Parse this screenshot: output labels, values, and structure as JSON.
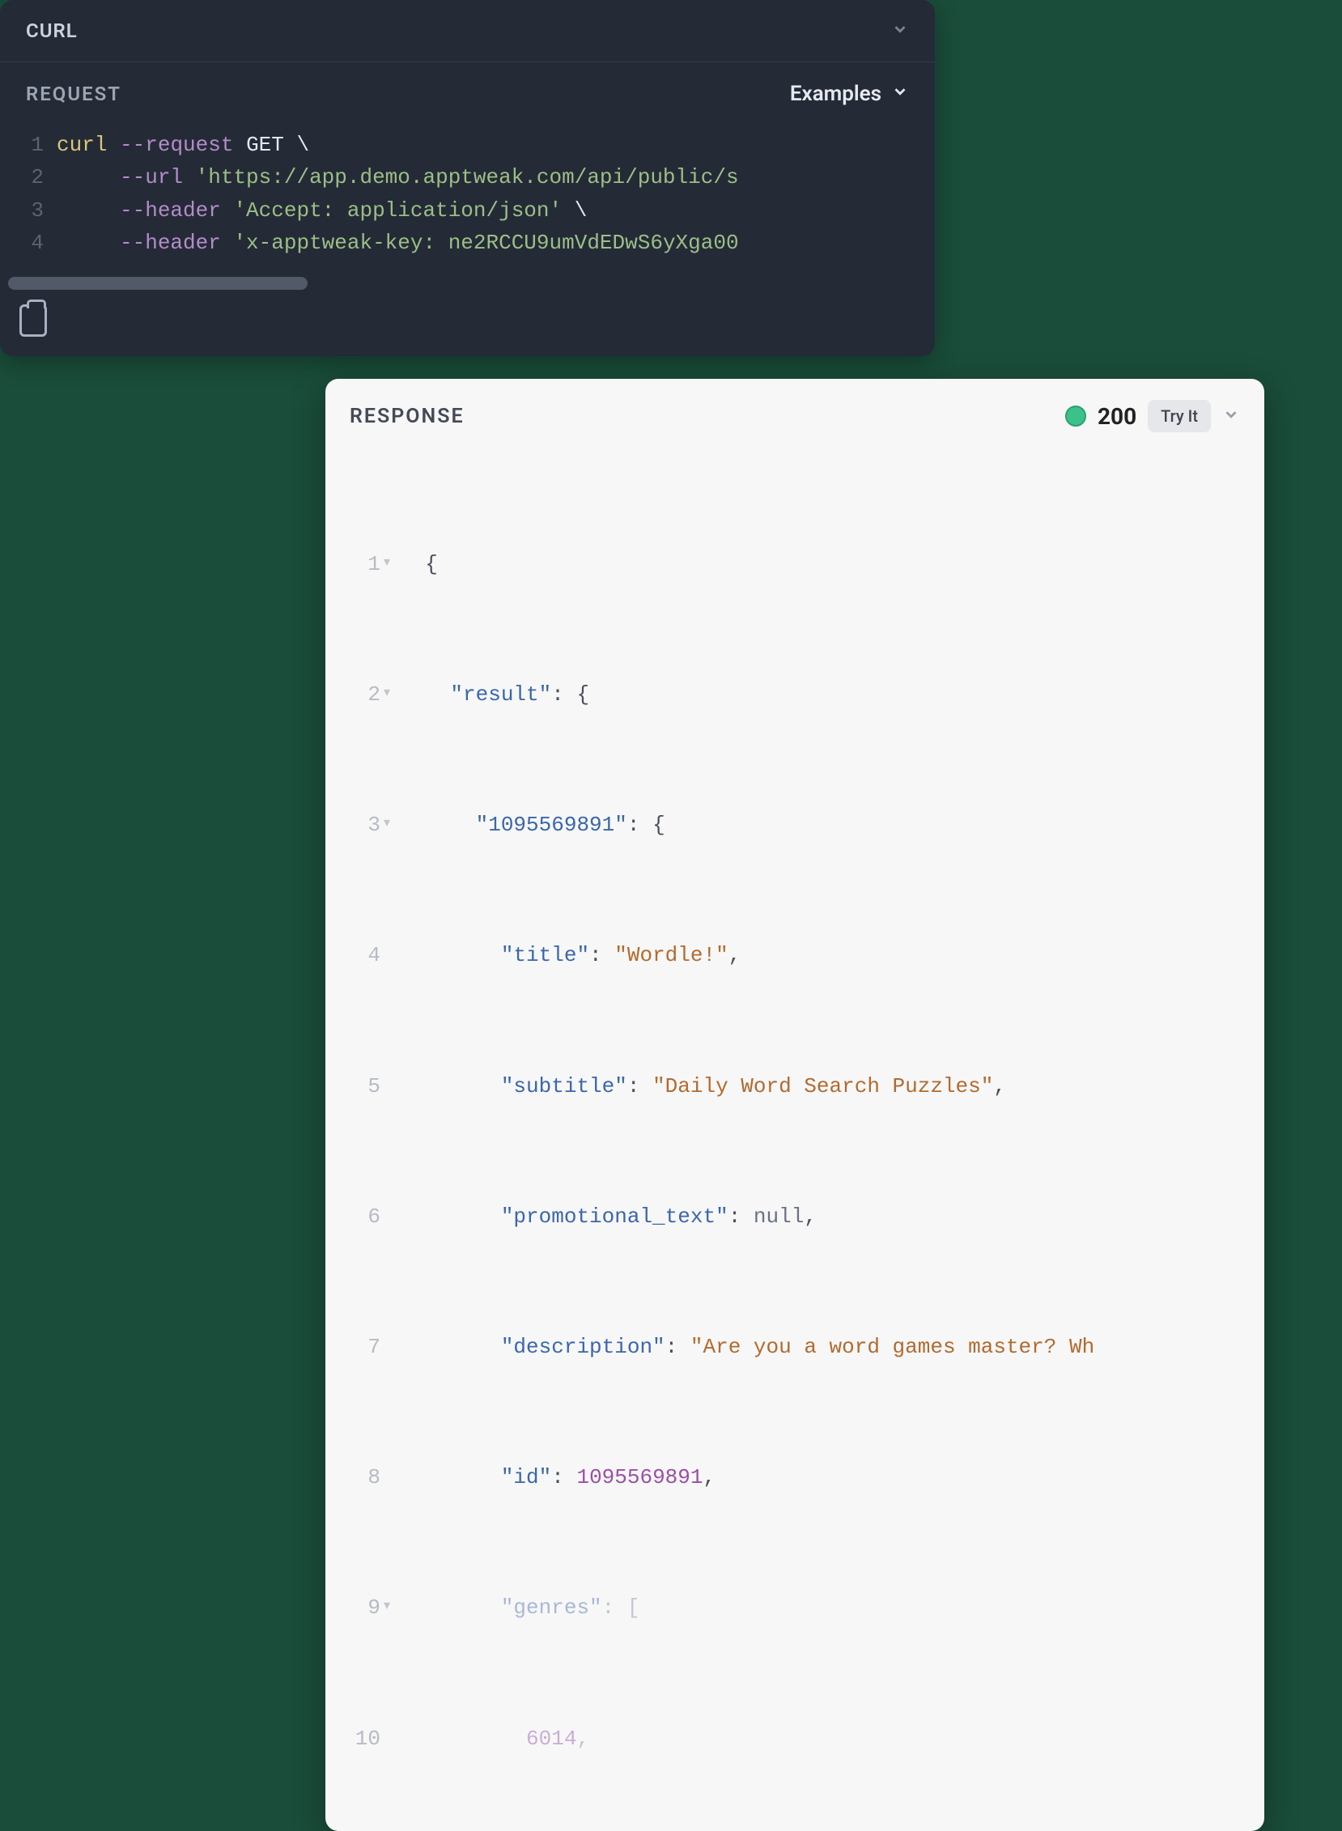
{
  "request": {
    "lang_label": "CURL",
    "section_label": "REQUEST",
    "examples_label": "Examples",
    "code": {
      "line_numbers": [
        "1",
        "2",
        "3",
        "4"
      ],
      "cmd": "curl",
      "flag_request": "--request",
      "method": "GET",
      "backslash": "\\",
      "flag_url": "--url",
      "url_value": "'https://app.demo.apptweak.com/api/public/s",
      "flag_header": "--header",
      "header_accept": "'Accept: application/json'",
      "header_key": "'x-apptweak-key: ne2RCCU9umVdEDwS6yXga00"
    }
  },
  "response": {
    "section_label": "RESPONSE",
    "status_code": "200",
    "tryit_label": "Try It",
    "json": {
      "line_numbers": [
        "1",
        "2",
        "3",
        "4",
        "5",
        "6",
        "7",
        "8",
        "9",
        "10"
      ],
      "fold_markers": [
        "▾",
        "▾",
        "▾",
        "",
        "",
        "",
        "",
        "",
        "▾",
        ""
      ],
      "brace_open": "{",
      "bracket_open": "[",
      "key_result": "\"result\"",
      "key_id_obj": "\"1095569891\"",
      "key_title": "\"title\"",
      "val_title": "\"Wordle!\"",
      "key_subtitle": "\"subtitle\"",
      "val_subtitle": "\"Daily Word Search Puzzles\"",
      "key_promo": "\"promotional_text\"",
      "val_null": "null",
      "key_desc": "\"description\"",
      "val_desc": "\"Are you a word games master? Wh",
      "key_id": "\"id\"",
      "val_id": "1095569891",
      "key_genres": "\"genres\"",
      "val_genre0": "6014",
      "colon": ":",
      "comma": ","
    }
  }
}
